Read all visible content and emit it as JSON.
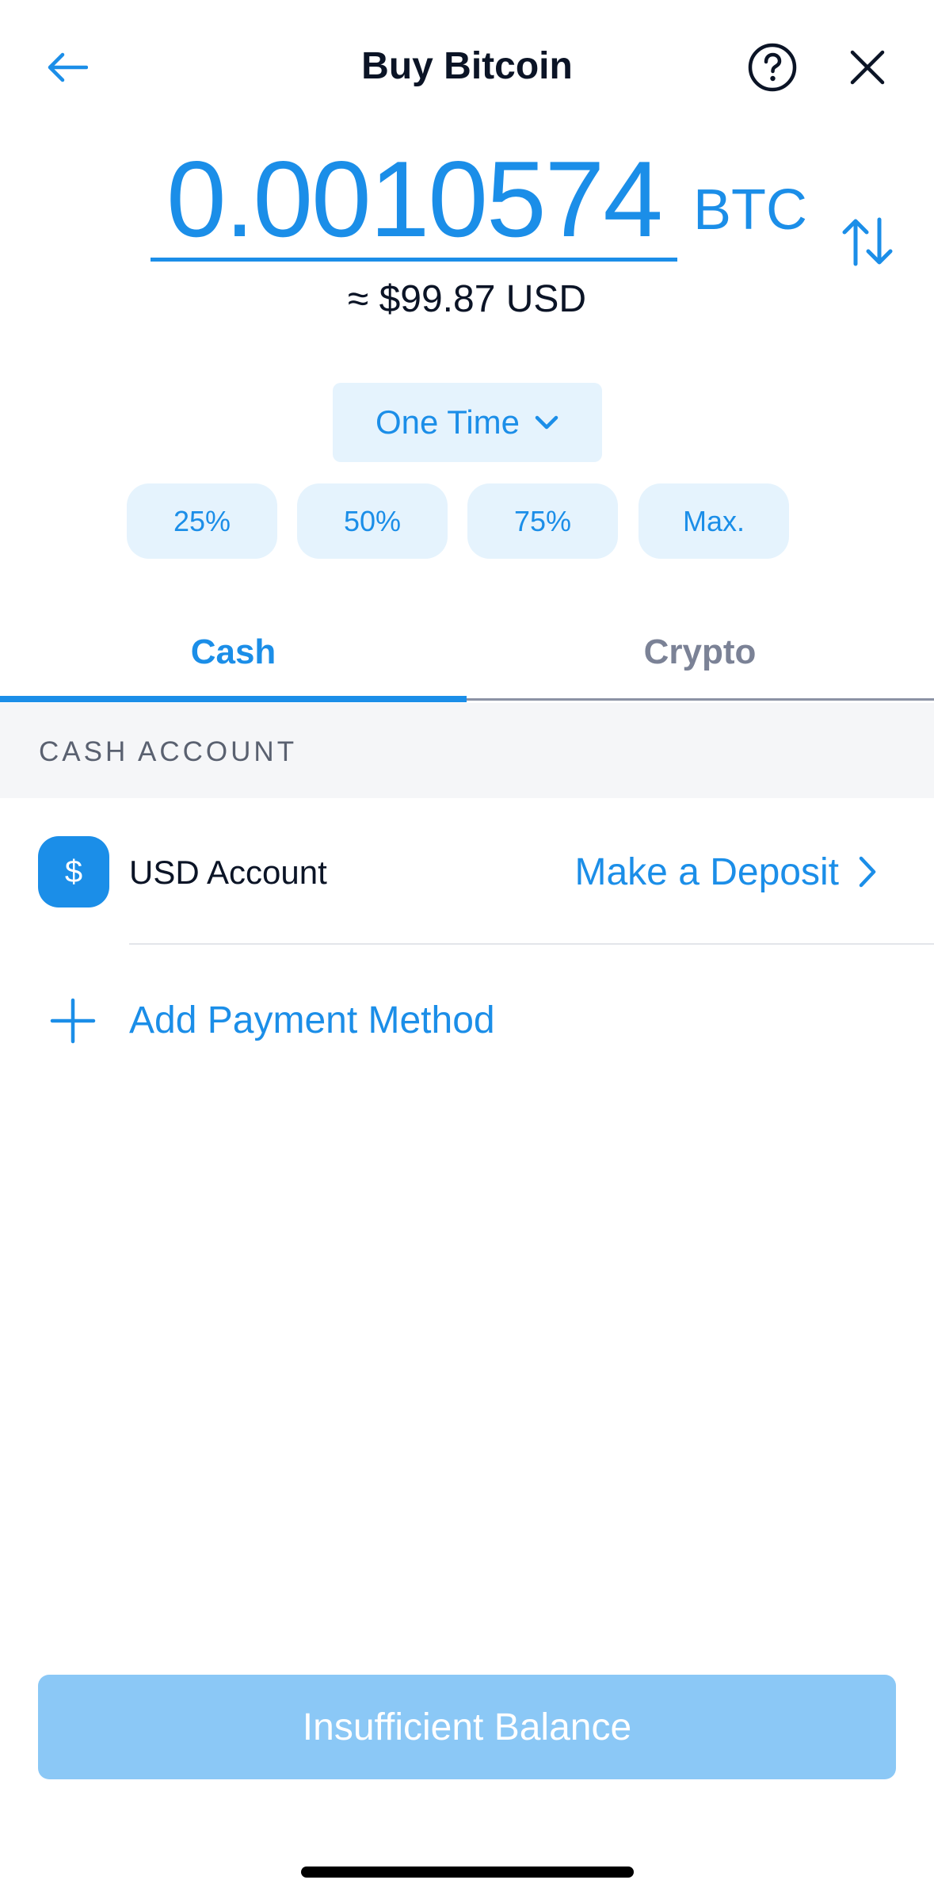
{
  "header": {
    "title": "Buy Bitcoin",
    "back_icon": "arrow-left-icon",
    "help_icon": "question-circle-icon",
    "close_icon": "close-icon"
  },
  "amount": {
    "value": "0.0010574",
    "currency": "BTC",
    "usd_approx": "≈ $99.87 USD",
    "swap_icon": "swap-vertical-icon"
  },
  "frequency": {
    "selected": "One Time",
    "icon": "chevron-down-icon"
  },
  "percent_buttons": [
    "25%",
    "50%",
    "75%",
    "Max."
  ],
  "tabs": [
    {
      "label": "Cash",
      "active": true
    },
    {
      "label": "Crypto",
      "active": false
    }
  ],
  "section": {
    "title": "CASH ACCOUNT"
  },
  "account": {
    "icon_symbol": "$",
    "name": "USD Account",
    "action": "Make a Deposit"
  },
  "add_payment": {
    "label": "Add Payment Method"
  },
  "cta": {
    "label": "Insufficient Balance"
  },
  "colors": {
    "accent": "#1b8ee8",
    "accent_light": "#e5f3fd",
    "cta_disabled": "#8bc8f6",
    "text_dark": "#0b1426",
    "text_muted": "#7b8296",
    "section_bg": "#f5f6f8"
  }
}
